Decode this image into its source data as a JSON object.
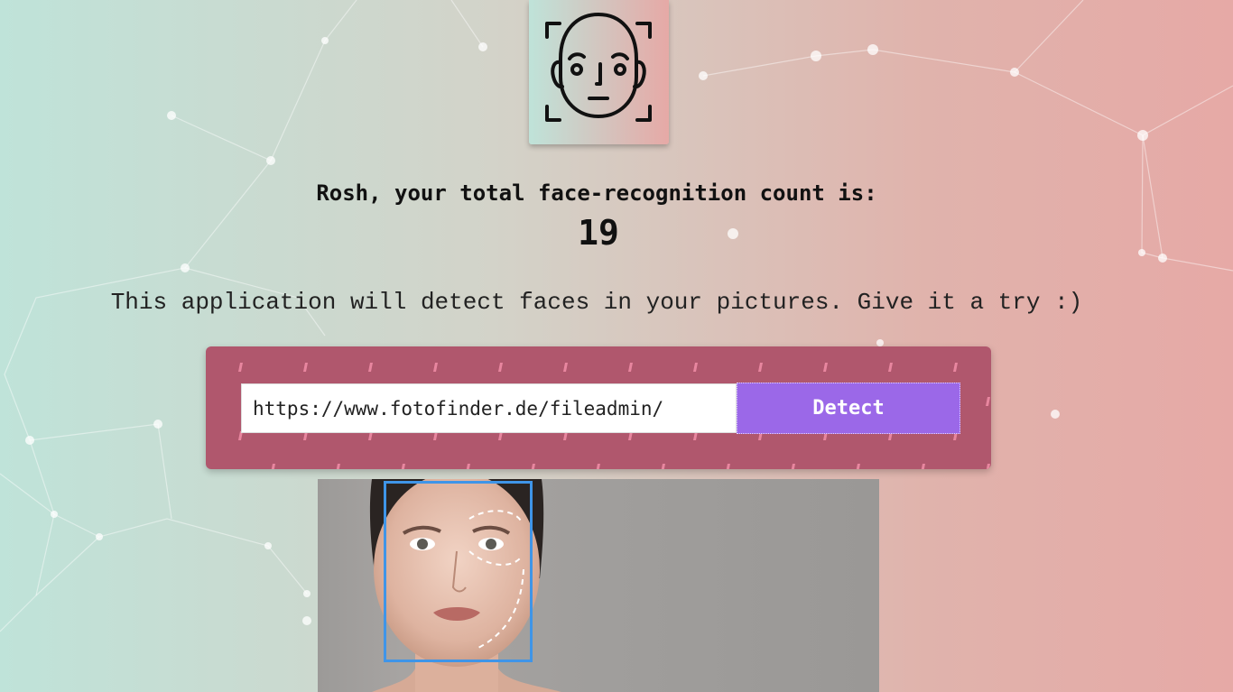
{
  "app": {
    "logo_icon": "face-scan-icon"
  },
  "greeting": {
    "user_name": "Rosh",
    "title": "Rosh, your total face-recognition count is:",
    "count": "19"
  },
  "intro": {
    "text": "This application will detect faces in your pictures. Give it a try :)"
  },
  "form": {
    "url_value": "https://www.fotofinder.de/fileadmin/",
    "detect_label": "Detect"
  },
  "result": {
    "image_icon": "portrait-photo",
    "faces_detected": 1
  },
  "colors": {
    "background_left": "#bfe3d9",
    "background_right": "#e6a9a6",
    "panel": "#b0576d",
    "panel_pattern": "#f28fa8",
    "button": "#9b68e8",
    "face_box": "#3f95e8"
  }
}
